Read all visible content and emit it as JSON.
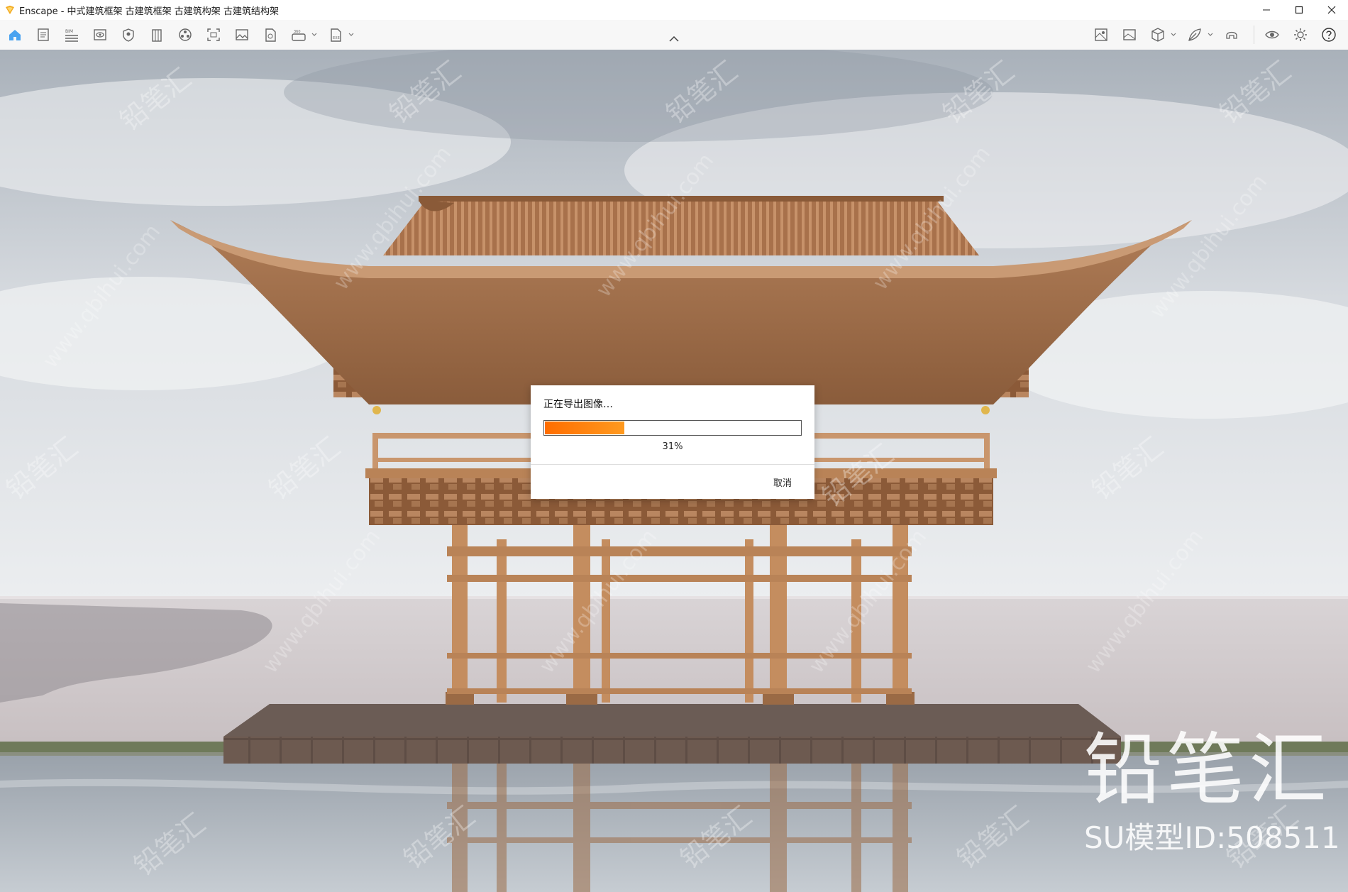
{
  "window": {
    "title": "Enscape - 中式建筑框架 古建筑框架 古建筑构架  古建筑结构架",
    "controls": [
      "minimize",
      "maximize",
      "close"
    ]
  },
  "toolbar": {
    "left_icons": [
      "home-icon",
      "document-icon",
      "bim-icon",
      "view-icon",
      "shield-icon",
      "building-icon",
      "materials-icon",
      "screenshot-icon",
      "image-icon",
      "file-icon",
      "panorama-icon",
      "export-icon"
    ],
    "right_icons": [
      "map-icon",
      "picture-icon",
      "cube-icon",
      "leaf-icon",
      "headset-icon",
      "eye-icon",
      "settings-icon",
      "help-icon"
    ]
  },
  "dialog": {
    "title": "正在导出图像…",
    "progress": 0.31,
    "progress_text": "31%",
    "cancel_label": "取消"
  },
  "watermark": {
    "brand": "铅笔汇",
    "url": "www.qbihui.com",
    "model_id": "SU模型ID:508511"
  },
  "colors": {
    "progress_start": "#ff6d00",
    "progress_end": "#ff9a1f",
    "accent_icon": "#3b82f6"
  }
}
